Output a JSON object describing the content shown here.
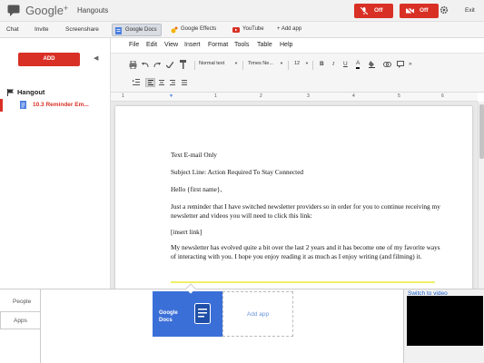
{
  "app": {
    "brand": "Google",
    "brand_plus": "+",
    "name": "Hangouts"
  },
  "header": {
    "mic_button": {
      "label": "Off",
      "icon": "mic-off-icon"
    },
    "camera_button": {
      "label": "Off",
      "icon": "camera-off-icon"
    },
    "settings_icon": "gear-icon",
    "exit_label": "Exit"
  },
  "nav_tabs": [
    "Chat",
    "Invite",
    "Screenshare"
  ],
  "app_buttons": [
    {
      "label": "Google Docs",
      "icon": "docs-icon",
      "active": true
    },
    {
      "label": "Google Effects",
      "icon": "effects-icon",
      "active": false
    },
    {
      "label": "YouTube",
      "icon": "youtube-icon",
      "active": false
    },
    {
      "label": "+ Add app",
      "icon": "",
      "active": false
    }
  ],
  "sidebar": {
    "add_label": "ADD",
    "collapse_icon": "chevron-left-icon",
    "section_title": "Hangout",
    "doc_item": "10.3 Reminder Em..."
  },
  "docs_menu": [
    "File",
    "Edit",
    "View",
    "Insert",
    "Format",
    "Tools",
    "Table",
    "Help"
  ],
  "toolbar": {
    "style_select": "Normal text",
    "font_select": "Times Ne...",
    "size_select": "12",
    "bold": "B",
    "italic": "I",
    "underline": "U",
    "text_color": "A"
  },
  "ruler_numbers": [
    "1",
    "1",
    "2",
    "3",
    "4",
    "5",
    "6"
  ],
  "document": {
    "line1": "Text E-mail Only",
    "line2": "Subject Line: Action Required To Stay Connected",
    "line3": "Hello {first name},",
    "line4": "Just a reminder that I have switched newsletter providers so in order for you to continue receiving my newsletter and videos you will need to click this link:",
    "line5": "[insert link]",
    "line6": "My newsletter has evolved quite a bit over the last 2 years and it has become one of my favorite ways of interacting with you. I hope you enjoy reading it as much as I enjoy writing (and filming) it."
  },
  "bottom": {
    "tabs": [
      "People",
      "Apps"
    ],
    "active_tab": "Apps",
    "app_card": "Google Docs",
    "add_app": "Add app",
    "switch_video": "Switch to video"
  },
  "colors": {
    "accent_red": "#d93025",
    "docs_blue": "#3b6fd8",
    "link_blue": "#1a5ec9"
  }
}
